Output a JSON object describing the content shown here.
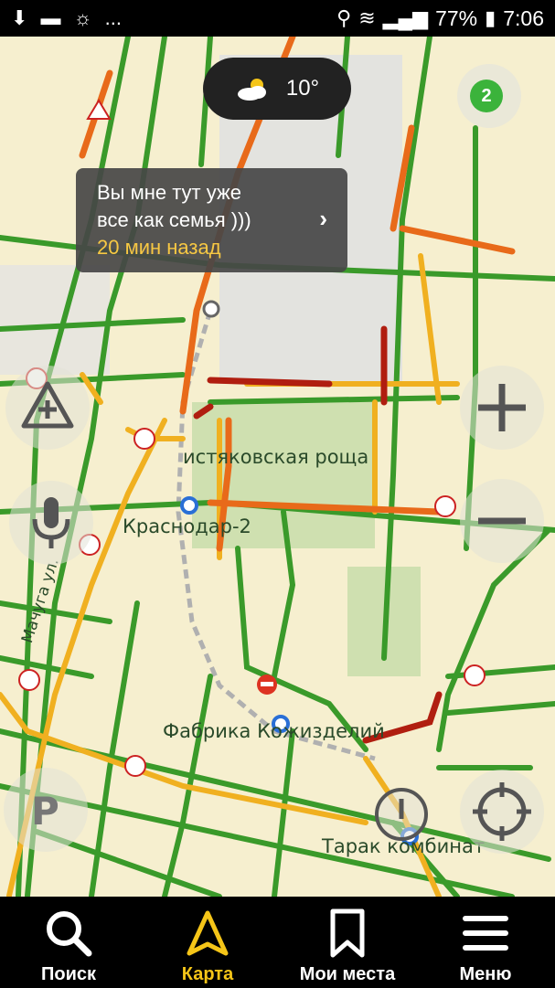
{
  "status_bar": {
    "battery_percent": "77%",
    "time": "7:06",
    "more": "..."
  },
  "weather": {
    "temperature": "10°"
  },
  "traffic": {
    "level": "2",
    "color": "#3bb33b"
  },
  "balloon": {
    "line1": "Вы мне тут уже",
    "line2": "все как семья )))",
    "time_ago": "20 мин назад"
  },
  "map_labels": {
    "park": "истяковская роща",
    "station1": "Краснодар-2",
    "station2": "Фабрика Кожизделий",
    "station3": "Тарак комбинат",
    "street": "Мачуга ул."
  },
  "nav": {
    "search": "Поиск",
    "map": "Карта",
    "places": "Мои места",
    "menu": "Меню"
  },
  "colors": {
    "green": "#3a9a2a",
    "yellow": "#f0b020",
    "orange": "#e86a1a",
    "red": "#b01e10",
    "accent": "#f5c518"
  }
}
